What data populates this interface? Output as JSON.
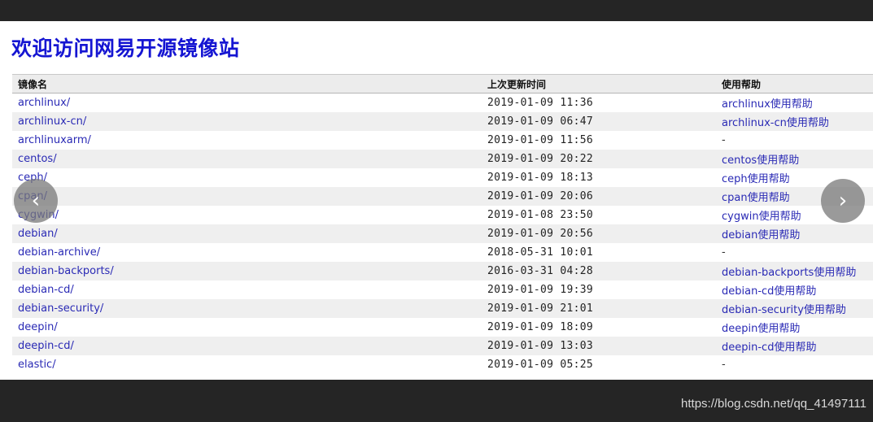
{
  "page": {
    "title": "欢迎访问网易开源镜像站"
  },
  "table": {
    "headers": {
      "name": "镜像名",
      "updated": "上次更新时间",
      "help": "使用帮助"
    },
    "rows": [
      {
        "name": "archlinux/",
        "time": "2019-01-09 11:36",
        "help": "archlinux使用帮助"
      },
      {
        "name": "archlinux-cn/",
        "time": "2019-01-09 06:47",
        "help": "archlinux-cn使用帮助"
      },
      {
        "name": "archlinuxarm/",
        "time": "2019-01-09 11:56",
        "help": "-"
      },
      {
        "name": "centos/",
        "time": "2019-01-09 20:22",
        "help": "centos使用帮助"
      },
      {
        "name": "ceph/",
        "time": "2019-01-09 18:13",
        "help": "ceph使用帮助"
      },
      {
        "name": "cpan/",
        "time": "2019-01-09 20:06",
        "help": "cpan使用帮助"
      },
      {
        "name": "cygwin/",
        "time": "2019-01-08 23:50",
        "help": "cygwin使用帮助"
      },
      {
        "name": "debian/",
        "time": "2019-01-09 20:56",
        "help": "debian使用帮助"
      },
      {
        "name": "debian-archive/",
        "time": "2018-05-31 10:01",
        "help": "-"
      },
      {
        "name": "debian-backports/",
        "time": "2016-03-31 04:28",
        "help": "debian-backports使用帮助"
      },
      {
        "name": "debian-cd/",
        "time": "2019-01-09 19:39",
        "help": "debian-cd使用帮助"
      },
      {
        "name": "debian-security/",
        "time": "2019-01-09 21:01",
        "help": "debian-security使用帮助"
      },
      {
        "name": "deepin/",
        "time": "2019-01-09 18:09",
        "help": "deepin使用帮助"
      },
      {
        "name": "deepin-cd/",
        "time": "2019-01-09 13:03",
        "help": "deepin-cd使用帮助"
      },
      {
        "name": "elastic/",
        "time": "2019-01-09 05:25",
        "help": "-"
      }
    ]
  },
  "viewer": {
    "prev_icon": "chevron-left-icon",
    "next_icon": "chevron-right-icon",
    "prev_glyph": "‹",
    "next_glyph": "›"
  },
  "watermark": "https://blog.csdn.net/qq_41497111",
  "colors": {
    "title": "#1515d2",
    "link": "#2a2ab5",
    "stripe": "#efefef",
    "frame": "#252525"
  }
}
